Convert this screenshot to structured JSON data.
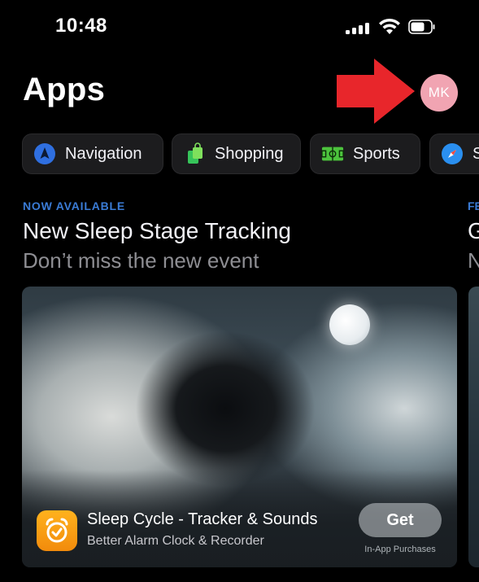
{
  "status_bar": {
    "time": "10:48"
  },
  "header": {
    "title": "Apps",
    "avatar_initials": "MK"
  },
  "annotation": {
    "arrow_color": "#e8262b"
  },
  "categories": [
    {
      "label": "Navigation",
      "icon": "navigation-icon"
    },
    {
      "label": "Shopping",
      "icon": "shopping-bag-icon"
    },
    {
      "label": "Sports",
      "icon": "sports-field-icon"
    },
    {
      "label": "S",
      "icon": "compass-icon"
    }
  ],
  "feature": {
    "eyebrow": "NOW AVAILABLE",
    "title": "New Sleep Stage Tracking",
    "subtitle": "Don’t miss the new event"
  },
  "next_feature": {
    "eyebrow": "FE",
    "title": "G",
    "subtitle": "N"
  },
  "card": {
    "app_name": "Sleep Cycle - Tracker & Sounds",
    "app_subtitle": "Better Alarm Clock & Recorder",
    "get_label": "Get",
    "iap_note": "In-App Purchases",
    "app_icon": "alarm-clock-icon"
  },
  "colors": {
    "accent": "#3a7bd5",
    "avatar": "#f1a4b2",
    "app_icon": "#f7a013"
  }
}
